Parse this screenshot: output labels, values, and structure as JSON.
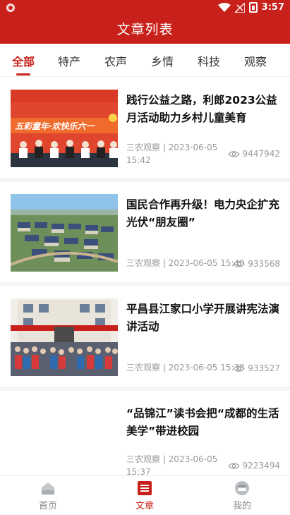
{
  "status_bar": {
    "time": "3:57"
  },
  "header": {
    "title": "文章列表"
  },
  "tabs": [
    {
      "label": "全部",
      "active": true
    },
    {
      "label": "特产",
      "active": false
    },
    {
      "label": "农声",
      "active": false
    },
    {
      "label": "乡情",
      "active": false
    },
    {
      "label": "科技",
      "active": false
    },
    {
      "label": "观察",
      "active": false
    }
  ],
  "articles": [
    {
      "title": "践行公益之路，利郎2023公益月活动助力乡村儿童美育",
      "source_date": "三农观察 | 2023-06-05 15:42",
      "views": "9447942",
      "banner_text": "五彩童年·欢快乐六一"
    },
    {
      "title": "国民合作再升级！电力央企扩充光伏“朋友圈”",
      "source_date": "三农观察 | 2023-06-05 15:40",
      "views": "933568"
    },
    {
      "title": "平昌县江家口小学开展讲宪法演讲活动",
      "source_date": "三农观察 | 2023-06-05 15:38",
      "views": "933527"
    },
    {
      "title": "“品锦江”读书会把“成都的生活美学”带进校园",
      "source_date": "三农观察 | 2023-06-05 15:37",
      "views": "9223494"
    }
  ],
  "bottom_nav": [
    {
      "label": "首页",
      "icon": "home-icon",
      "active": false
    },
    {
      "label": "文章",
      "icon": "article-icon",
      "active": true
    },
    {
      "label": "我的",
      "icon": "profile-icon",
      "active": false
    }
  ],
  "colors": {
    "brand": "#c8201a",
    "muted_text": "#999999"
  }
}
